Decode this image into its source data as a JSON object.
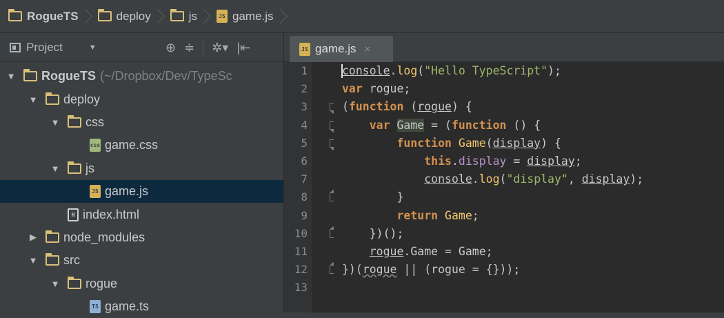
{
  "breadcrumb": [
    "RogueTS",
    "deploy",
    "js",
    "game.js"
  ],
  "panel": {
    "title": "Project",
    "tools": [
      "⊕",
      "≑",
      "✲▾",
      "|⇤"
    ]
  },
  "tree": [
    {
      "label": "RogueTS",
      "path": "(~/Dropbox/Dev/TypeSc",
      "arrow": "▼",
      "icon": "folder",
      "indent": 0,
      "bold": true
    },
    {
      "label": "deploy",
      "arrow": "▼",
      "icon": "folder",
      "indent": 1
    },
    {
      "label": "css",
      "arrow": "▼",
      "icon": "folder",
      "indent": 2
    },
    {
      "label": "game.css",
      "icon": "css",
      "indent": 3
    },
    {
      "label": "js",
      "arrow": "▼",
      "icon": "folder",
      "indent": 2
    },
    {
      "label": "game.js",
      "icon": "js",
      "indent": 3,
      "selected": true
    },
    {
      "label": "index.html",
      "icon": "html",
      "indent": 2
    },
    {
      "label": "node_modules",
      "arrow": "▶",
      "icon": "folder",
      "indent": 1
    },
    {
      "label": "src",
      "arrow": "▼",
      "icon": "folder",
      "indent": 1
    },
    {
      "label": "rogue",
      "arrow": "▼",
      "icon": "folder",
      "indent": 2
    },
    {
      "label": "game.ts",
      "icon": "ts",
      "indent": 3
    }
  ],
  "editor": {
    "tab_label": "game.js",
    "tab_close": "×",
    "line_numbers": [
      "1",
      "2",
      "3",
      "4",
      "5",
      "6",
      "7",
      "8",
      "9",
      "10",
      "11",
      "12",
      "13"
    ],
    "lines": [
      [
        {
          "t": "console",
          "c": "ul"
        },
        {
          "t": "."
        },
        {
          "t": "log",
          "c": "fn"
        },
        {
          "t": "("
        },
        {
          "t": "\"Hello TypeScript\"",
          "c": "str"
        },
        {
          "t": ");"
        }
      ],
      [
        {
          "t": "var ",
          "c": "kw"
        },
        {
          "t": "rogue;"
        }
      ],
      [
        {
          "t": "("
        },
        {
          "t": "function ",
          "c": "kw"
        },
        {
          "t": "("
        },
        {
          "t": "rogue",
          "c": "ul"
        },
        {
          "t": ") {"
        }
      ],
      [
        {
          "t": "    "
        },
        {
          "t": "var ",
          "c": "kw"
        },
        {
          "t": "Game",
          "c": "hl"
        },
        {
          "t": " = ("
        },
        {
          "t": "function ",
          "c": "kw"
        },
        {
          "t": "() {"
        }
      ],
      [
        {
          "t": "        "
        },
        {
          "t": "function ",
          "c": "kw"
        },
        {
          "t": "Game",
          "c": "fn"
        },
        {
          "t": "("
        },
        {
          "t": "display",
          "c": "ul"
        },
        {
          "t": ") {"
        }
      ],
      [
        {
          "t": "            "
        },
        {
          "t": "this",
          "c": "kw"
        },
        {
          "t": "."
        },
        {
          "t": "display",
          "c": "prop"
        },
        {
          "t": " = "
        },
        {
          "t": "display",
          "c": "ul"
        },
        {
          "t": ";"
        }
      ],
      [
        {
          "t": "            "
        },
        {
          "t": "console",
          "c": "ul"
        },
        {
          "t": "."
        },
        {
          "t": "log",
          "c": "fn"
        },
        {
          "t": "("
        },
        {
          "t": "\"display\"",
          "c": "str"
        },
        {
          "t": ", "
        },
        {
          "t": "display",
          "c": "ul"
        },
        {
          "t": ");"
        }
      ],
      [
        {
          "t": "        }"
        }
      ],
      [
        {
          "t": "        "
        },
        {
          "t": "return ",
          "c": "kw"
        },
        {
          "t": "Game",
          "c": "fn"
        },
        {
          "t": ";"
        }
      ],
      [
        {
          "t": "    })();"
        }
      ],
      [
        {
          "t": "    "
        },
        {
          "t": "rogue",
          "c": "ul"
        },
        {
          "t": ".Game = Game;"
        }
      ],
      [
        {
          "t": "})("
        },
        {
          "t": "rogue",
          "c": "wavy"
        },
        {
          "t": " || ("
        },
        {
          "t": "rogue",
          "c": ""
        },
        {
          "t": " = {}));"
        }
      ],
      []
    ],
    "folds": [
      {
        "line": 3,
        "type": "open"
      },
      {
        "line": 4,
        "type": "open"
      },
      {
        "line": 5,
        "type": "open"
      },
      {
        "line": 8,
        "type": "end"
      },
      {
        "line": 10,
        "type": "end"
      },
      {
        "line": 12,
        "type": "end"
      }
    ]
  },
  "colors": {
    "background": "#3c3f41",
    "editor_bg": "#2b2b2b",
    "keyword": "#d3914f",
    "string": "#9fb76c",
    "selection": "#0d293e",
    "folder": "#d9c07a"
  }
}
